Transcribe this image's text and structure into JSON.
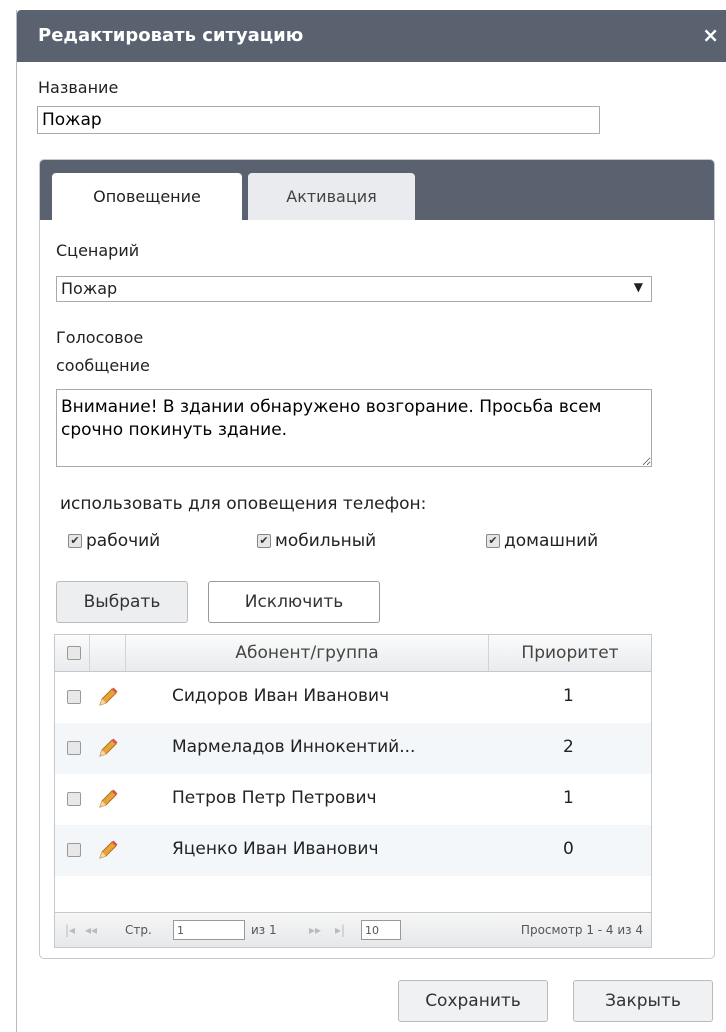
{
  "dialog": {
    "title": "Редактировать ситуацию",
    "close_glyph": "×"
  },
  "name_field": {
    "label": "Название",
    "value": "Пожар"
  },
  "tabs": [
    {
      "label": "Оповещение",
      "active": true
    },
    {
      "label": "Активация",
      "active": false
    }
  ],
  "scenario": {
    "label": "Сценарий",
    "value": "Пожар",
    "arrow": "▼"
  },
  "voice_message": {
    "label_line1": "Голосовое",
    "label_line2": "сообщение",
    "value": "Внимание! В здании обнаружено возгорание. Просьба всем срочно покинуть здание."
  },
  "phones": {
    "label": "использовать для оповещения телефон:",
    "options": [
      {
        "label": "рабочий",
        "checked": true
      },
      {
        "label": "мобильный",
        "checked": true
      },
      {
        "label": "домашний",
        "checked": true
      }
    ]
  },
  "actions": {
    "select_label": "Выбрать",
    "exclude_label": "Исключить"
  },
  "grid": {
    "columns": {
      "name": "Абонент/группа",
      "priority": "Приоритет"
    },
    "rows": [
      {
        "name": "Сидоров Иван Иванович",
        "priority": "1"
      },
      {
        "name": "Мармеладов Иннокентий...",
        "priority": "2"
      },
      {
        "name": "Петров Петр Петрович",
        "priority": "1"
      },
      {
        "name": "Яценко Иван Иванович",
        "priority": "0"
      }
    ],
    "pager": {
      "page_label": "Стр.",
      "page_value": "1",
      "of_label": "из 1",
      "page_size": "10",
      "summary": "Просмотр 1 - 4 из 4"
    }
  },
  "footer": {
    "save_label": "Сохранить",
    "close_label": "Закрыть"
  },
  "colors": {
    "header": "#5a6270",
    "tab_inactive": "#e9ebee",
    "row_alt": "#f4f7fa",
    "pencil": "#e8a33a"
  }
}
